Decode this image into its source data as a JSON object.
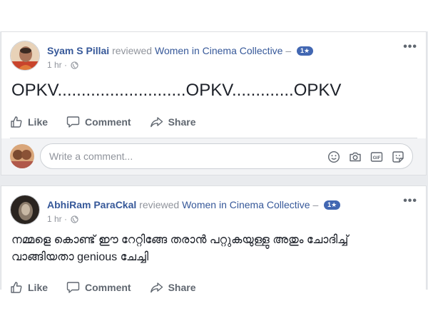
{
  "posts": [
    {
      "author": "Syam S Pillai",
      "verb": "reviewed",
      "page": "Women in Cinema Collective",
      "dash": "–",
      "rating": "1★",
      "time": "1 hr",
      "separator": "·",
      "text": "OPKV...........................OPKV.............OPKV",
      "more": "•••",
      "actions": {
        "like": "Like",
        "comment": "Comment",
        "share": "Share"
      },
      "comment_placeholder": "Write a comment..."
    },
    {
      "author": "AbhiRam ParaCkal",
      "verb": "reviewed",
      "page": "Women in Cinema Collective",
      "dash": "–",
      "rating": "1★",
      "time": "1 hr",
      "separator": "·",
      "text": "നമ്മളെ കൊണ്ട് ഈ റേറ്റിങ്ങേ തരാൻ പറ്റുകയുള്ളു അതും ചോദിച്ച് വാങ്ങിയതാ genious ചേച്ചി",
      "more": "•••",
      "actions": {
        "like": "Like",
        "comment": "Comment",
        "share": "Share"
      }
    }
  ],
  "icons": {
    "globe": "globe-icon",
    "like": "thumbs-up-icon",
    "comment": "speech-bubble-icon",
    "share": "share-arrow-icon",
    "emoji": "smiley-icon",
    "camera": "camera-icon",
    "gif": "gif-icon",
    "sticker": "sticker-icon"
  },
  "colors": {
    "link": "#365899",
    "muted": "#90949c",
    "action": "#606770",
    "badge": "#4267b2",
    "background": "#e9ebee"
  }
}
